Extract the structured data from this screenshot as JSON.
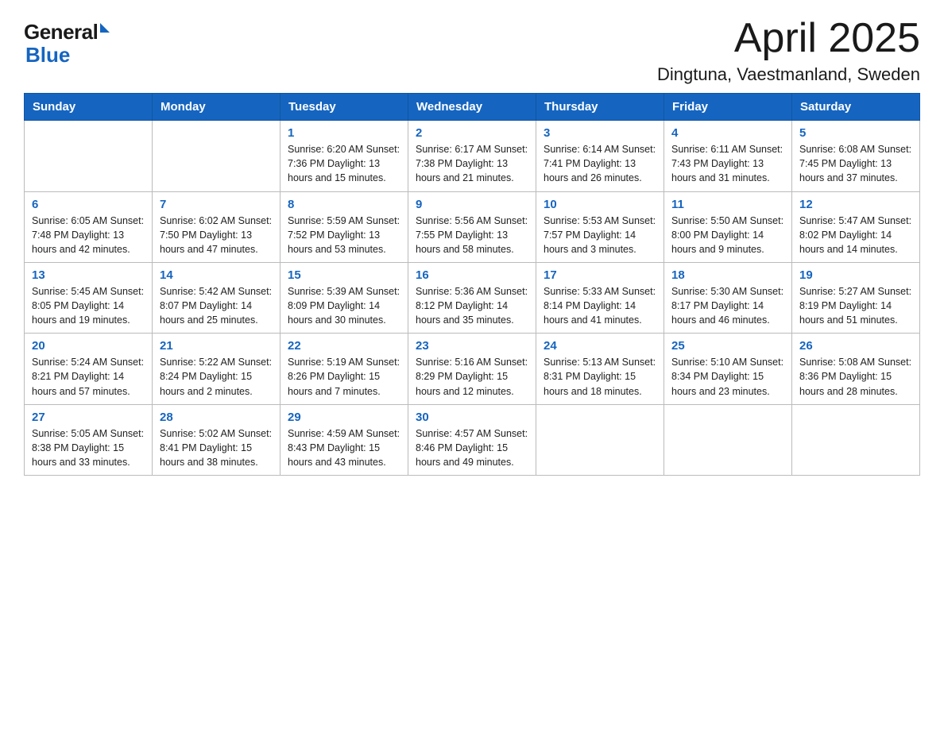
{
  "logo": {
    "general": "General",
    "blue": "Blue"
  },
  "title": "April 2025",
  "subtitle": "Dingtuna, Vaestmanland, Sweden",
  "weekdays": [
    "Sunday",
    "Monday",
    "Tuesday",
    "Wednesday",
    "Thursday",
    "Friday",
    "Saturday"
  ],
  "weeks": [
    [
      {
        "day": "",
        "info": ""
      },
      {
        "day": "",
        "info": ""
      },
      {
        "day": "1",
        "info": "Sunrise: 6:20 AM\nSunset: 7:36 PM\nDaylight: 13 hours\nand 15 minutes."
      },
      {
        "day": "2",
        "info": "Sunrise: 6:17 AM\nSunset: 7:38 PM\nDaylight: 13 hours\nand 21 minutes."
      },
      {
        "day": "3",
        "info": "Sunrise: 6:14 AM\nSunset: 7:41 PM\nDaylight: 13 hours\nand 26 minutes."
      },
      {
        "day": "4",
        "info": "Sunrise: 6:11 AM\nSunset: 7:43 PM\nDaylight: 13 hours\nand 31 minutes."
      },
      {
        "day": "5",
        "info": "Sunrise: 6:08 AM\nSunset: 7:45 PM\nDaylight: 13 hours\nand 37 minutes."
      }
    ],
    [
      {
        "day": "6",
        "info": "Sunrise: 6:05 AM\nSunset: 7:48 PM\nDaylight: 13 hours\nand 42 minutes."
      },
      {
        "day": "7",
        "info": "Sunrise: 6:02 AM\nSunset: 7:50 PM\nDaylight: 13 hours\nand 47 minutes."
      },
      {
        "day": "8",
        "info": "Sunrise: 5:59 AM\nSunset: 7:52 PM\nDaylight: 13 hours\nand 53 minutes."
      },
      {
        "day": "9",
        "info": "Sunrise: 5:56 AM\nSunset: 7:55 PM\nDaylight: 13 hours\nand 58 minutes."
      },
      {
        "day": "10",
        "info": "Sunrise: 5:53 AM\nSunset: 7:57 PM\nDaylight: 14 hours\nand 3 minutes."
      },
      {
        "day": "11",
        "info": "Sunrise: 5:50 AM\nSunset: 8:00 PM\nDaylight: 14 hours\nand 9 minutes."
      },
      {
        "day": "12",
        "info": "Sunrise: 5:47 AM\nSunset: 8:02 PM\nDaylight: 14 hours\nand 14 minutes."
      }
    ],
    [
      {
        "day": "13",
        "info": "Sunrise: 5:45 AM\nSunset: 8:05 PM\nDaylight: 14 hours\nand 19 minutes."
      },
      {
        "day": "14",
        "info": "Sunrise: 5:42 AM\nSunset: 8:07 PM\nDaylight: 14 hours\nand 25 minutes."
      },
      {
        "day": "15",
        "info": "Sunrise: 5:39 AM\nSunset: 8:09 PM\nDaylight: 14 hours\nand 30 minutes."
      },
      {
        "day": "16",
        "info": "Sunrise: 5:36 AM\nSunset: 8:12 PM\nDaylight: 14 hours\nand 35 minutes."
      },
      {
        "day": "17",
        "info": "Sunrise: 5:33 AM\nSunset: 8:14 PM\nDaylight: 14 hours\nand 41 minutes."
      },
      {
        "day": "18",
        "info": "Sunrise: 5:30 AM\nSunset: 8:17 PM\nDaylight: 14 hours\nand 46 minutes."
      },
      {
        "day": "19",
        "info": "Sunrise: 5:27 AM\nSunset: 8:19 PM\nDaylight: 14 hours\nand 51 minutes."
      }
    ],
    [
      {
        "day": "20",
        "info": "Sunrise: 5:24 AM\nSunset: 8:21 PM\nDaylight: 14 hours\nand 57 minutes."
      },
      {
        "day": "21",
        "info": "Sunrise: 5:22 AM\nSunset: 8:24 PM\nDaylight: 15 hours\nand 2 minutes."
      },
      {
        "day": "22",
        "info": "Sunrise: 5:19 AM\nSunset: 8:26 PM\nDaylight: 15 hours\nand 7 minutes."
      },
      {
        "day": "23",
        "info": "Sunrise: 5:16 AM\nSunset: 8:29 PM\nDaylight: 15 hours\nand 12 minutes."
      },
      {
        "day": "24",
        "info": "Sunrise: 5:13 AM\nSunset: 8:31 PM\nDaylight: 15 hours\nand 18 minutes."
      },
      {
        "day": "25",
        "info": "Sunrise: 5:10 AM\nSunset: 8:34 PM\nDaylight: 15 hours\nand 23 minutes."
      },
      {
        "day": "26",
        "info": "Sunrise: 5:08 AM\nSunset: 8:36 PM\nDaylight: 15 hours\nand 28 minutes."
      }
    ],
    [
      {
        "day": "27",
        "info": "Sunrise: 5:05 AM\nSunset: 8:38 PM\nDaylight: 15 hours\nand 33 minutes."
      },
      {
        "day": "28",
        "info": "Sunrise: 5:02 AM\nSunset: 8:41 PM\nDaylight: 15 hours\nand 38 minutes."
      },
      {
        "day": "29",
        "info": "Sunrise: 4:59 AM\nSunset: 8:43 PM\nDaylight: 15 hours\nand 43 minutes."
      },
      {
        "day": "30",
        "info": "Sunrise: 4:57 AM\nSunset: 8:46 PM\nDaylight: 15 hours\nand 49 minutes."
      },
      {
        "day": "",
        "info": ""
      },
      {
        "day": "",
        "info": ""
      },
      {
        "day": "",
        "info": ""
      }
    ]
  ]
}
